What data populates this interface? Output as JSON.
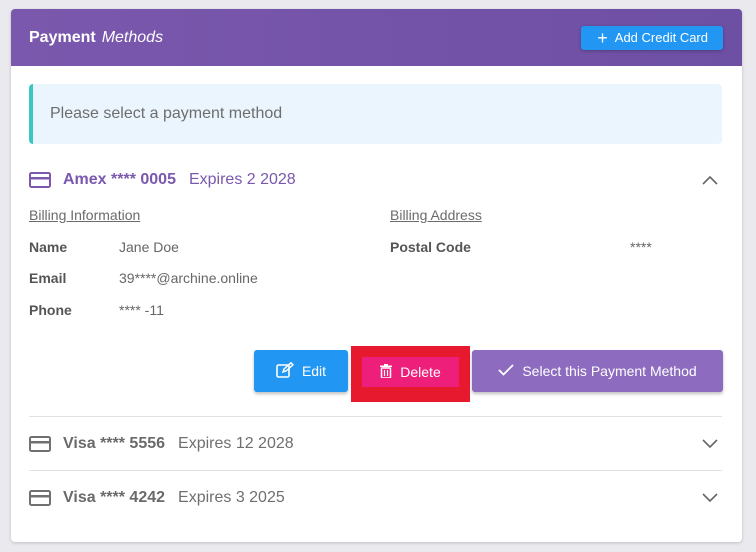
{
  "header": {
    "title_bold": "Payment",
    "title_italic": "Methods",
    "add_button_label": "Add Credit Card"
  },
  "notice": {
    "text": "Please select a payment method"
  },
  "methods": [
    {
      "brand": "Amex **** 0005",
      "expires": "Expires 2 2028",
      "expanded": true
    },
    {
      "brand": "Visa **** 5556",
      "expires": "Expires 12 2028",
      "expanded": false
    },
    {
      "brand": "Visa **** 4242",
      "expires": "Expires 3 2025",
      "expanded": false
    }
  ],
  "details": {
    "billing_info_heading": "Billing Information",
    "billing_address_heading": "Billing Address",
    "name_label": "Name",
    "name_value": "Jane Doe",
    "email_label": "Email",
    "email_value": "39****@archine.online",
    "phone_label": "Phone",
    "phone_value": "**** -11",
    "postal_label": "Postal Code",
    "postal_value": "****"
  },
  "actions": {
    "edit_label": "Edit",
    "delete_label": "Delete",
    "select_label": "Select this Payment Method"
  },
  "colors": {
    "header_purple": "#7a58ad",
    "accent_blue": "#2196f3",
    "delete_pink": "#ed1f7b",
    "highlight_red": "#e6192f",
    "select_purple": "#8d6bbf",
    "notice_border": "#3ac7c4"
  }
}
